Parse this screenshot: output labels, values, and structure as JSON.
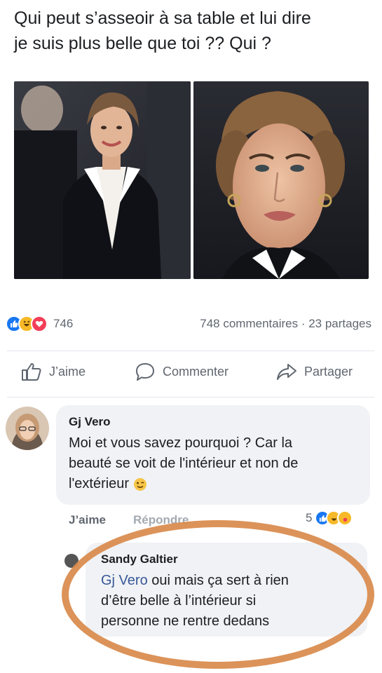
{
  "post": {
    "text_line1": "Qui peut s’asseoir à sa table et lui dire",
    "text_line2": "je suis plus belle que toi ?? Qui ?"
  },
  "reactions": {
    "icons": [
      "like-icon",
      "haha-icon",
      "love-icon"
    ],
    "count": "746"
  },
  "stats": {
    "comments": "748 commentaires",
    "separator": " · ",
    "shares": "23 partages"
  },
  "actions": {
    "like": "J’aime",
    "comment": "Commenter",
    "share": "Partager"
  },
  "comment1": {
    "author": "Gj Vero",
    "text_line1": "Moi et vous savez pourquoi ? Car la",
    "text_line2": "beauté se voit de l'intérieur et non de",
    "text_line3": "l'extérieur",
    "emoji": "wink-emoji",
    "like_label": "J’aime",
    "reply_label": "Répondre",
    "reaction_count": "5"
  },
  "comment2": {
    "author": "Sandy Galtier",
    "mention": "Gj Vero",
    "text_line1": " oui mais ça sert à rien",
    "text_line2": "d’être belle à l’intérieur si",
    "text_line3": "personne ne rentre dedans"
  },
  "colors": {
    "like_blue": "#1877f2",
    "haha_yellow": "#f7b928",
    "love_red": "#f33e58",
    "mention_blue": "#385898",
    "highlight_orange": "#d98a4b"
  }
}
